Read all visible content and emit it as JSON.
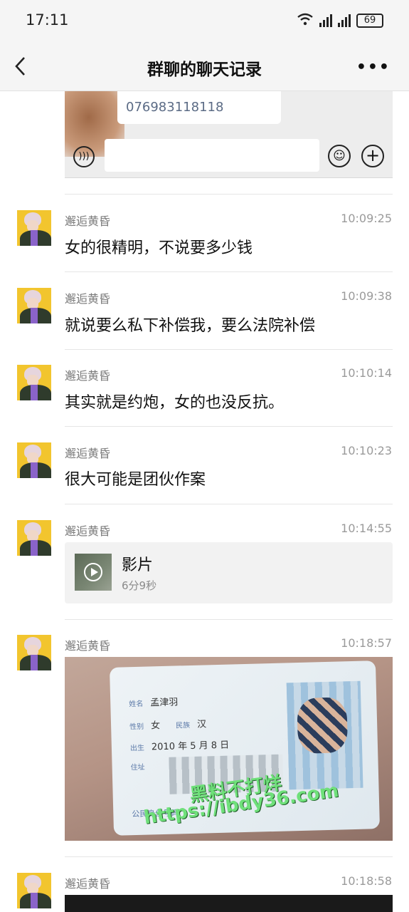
{
  "status_bar": {
    "time": "17:11",
    "battery": "69"
  },
  "nav": {
    "title": "群聊的聊天记录",
    "more": "•••"
  },
  "top_card": {
    "phone": "076983118118"
  },
  "messages": [
    {
      "sender": "邂逅黄昏",
      "time": "10:09:25",
      "text": "女的很精明，不说要多少钱"
    },
    {
      "sender": "邂逅黄昏",
      "time": "10:09:38",
      "text": "就说要么私下补偿我，要么法院补偿"
    },
    {
      "sender": "邂逅黄昏",
      "time": "10:10:14",
      "text": "其实就是约炮，女的也没反抗。"
    },
    {
      "sender": "邂逅黄昏",
      "time": "10:10:23",
      "text": "很大可能是团伙作案"
    },
    {
      "sender": "邂逅黄昏",
      "time": "10:14:55",
      "video": {
        "title": "影片",
        "duration": "6分9秒"
      }
    },
    {
      "sender": "邂逅黄昏",
      "time": "10:18:57",
      "image": {
        "name": "孟津羽",
        "gender": "女",
        "ethnicity": "汉",
        "birth": "2010 年 5 月 8 日",
        "labels": {
          "name": "姓名",
          "gender": "性别",
          "ethnicity": "民族",
          "birth": "出生",
          "address": "住址",
          "id": "公民身份号码"
        },
        "watermark_line1": "黑料不打烊",
        "watermark_line2": "https://ibdy36.com"
      }
    },
    {
      "sender": "邂逅黄昏",
      "time": "10:18:58"
    }
  ]
}
